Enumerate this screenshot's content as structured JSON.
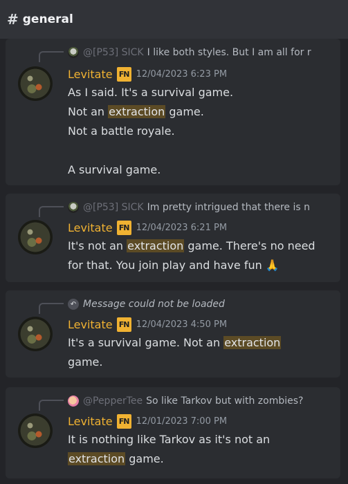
{
  "channel": {
    "hash": "#",
    "name": "general"
  },
  "messages": [
    {
      "reply": {
        "author": "@[P53] SICK",
        "text": "I like both styles. But I am all for r"
      },
      "author": "Levitate",
      "badge": "FN",
      "timestamp": "12/04/2023 6:23 PM",
      "lines": [
        {
          "pre": "As I said. It's a survival game.",
          "hl": "",
          "post": ""
        },
        {
          "pre": "Not an ",
          "hl": "extraction",
          "post": " game."
        },
        {
          "pre": "Not a battle royale.",
          "hl": "",
          "post": ""
        },
        {
          "pre": "",
          "hl": "",
          "post": ""
        },
        {
          "pre": "A survival game.",
          "hl": "",
          "post": ""
        }
      ]
    },
    {
      "reply": {
        "author": "@[P53] SICK",
        "text": "Im pretty intrigued that there is n"
      },
      "author": "Levitate",
      "badge": "FN",
      "timestamp": "12/04/2023 6:21 PM",
      "lines": [
        {
          "pre": "It's not an ",
          "hl": "extraction",
          "post": " game. There's no need"
        },
        {
          "pre": "for that. You join play and have fun ",
          "hl": "",
          "post": "",
          "emoji": "🙏"
        }
      ]
    },
    {
      "reply": {
        "author": "",
        "text": "Message could not be loaded"
      },
      "author": "Levitate",
      "badge": "FN",
      "timestamp": "12/04/2023 4:50 PM",
      "lines": [
        {
          "pre": "It's a survival game. Not an ",
          "hl": "extraction",
          "post": ""
        },
        {
          "pre": "game.",
          "hl": "",
          "post": ""
        }
      ]
    },
    {
      "reply": {
        "author": "@PepperTee",
        "text": "So like Tarkov but with zombies?"
      },
      "author": "Levitate",
      "badge": "FN",
      "timestamp": "12/01/2023 7:00 PM",
      "lines": [
        {
          "pre": "It is nothing like Tarkov as it's not an",
          "hl": "",
          "post": ""
        },
        {
          "pre": "",
          "hl": "extraction",
          "post": " game."
        }
      ]
    }
  ]
}
